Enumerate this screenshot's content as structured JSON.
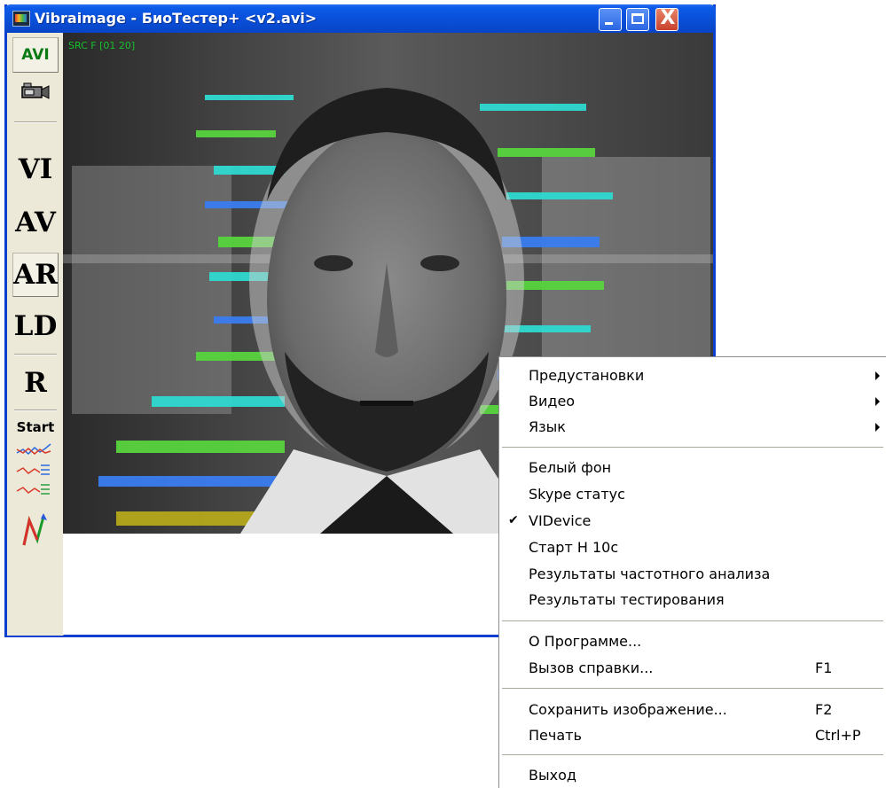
{
  "window": {
    "title": "Vibraimage - БиоТестер+ <v2.avi>",
    "close_glyph": "X"
  },
  "toolbar": {
    "avi": "AVI",
    "vi": "VI",
    "av": "AV",
    "ar": "AR",
    "ld": "LD",
    "r": "R",
    "start": "Start"
  },
  "video": {
    "overlay_label": "SRC F [01 20]"
  },
  "context_menu": {
    "items": [
      {
        "label": "Предустановки",
        "submenu": true
      },
      {
        "label": "Видео",
        "submenu": true
      },
      {
        "label": "Язык",
        "submenu": true
      },
      {
        "label": "Белый фон"
      },
      {
        "label": "Skype статус"
      },
      {
        "label": "VIDevice",
        "checked": true,
        "check_glyph": "✔"
      },
      {
        "label": "Старт Н 10с"
      },
      {
        "label": "Результаты частотного анализа"
      },
      {
        "label": "Результаты тестирования"
      },
      {
        "label": "О Программе..."
      },
      {
        "label": "Вызов справки...",
        "shortcut": "F1"
      },
      {
        "label": "Сохранить изображение...",
        "shortcut": "F2"
      },
      {
        "label": "Печать",
        "shortcut": "Ctrl+P"
      },
      {
        "label": "Выход"
      }
    ]
  },
  "colors": {
    "titlebar": "#0a4fd8",
    "window_face": "#ece9d8",
    "overlay_green": "#17c02a",
    "aura_cyan": "#2fd9d0",
    "aura_green": "#57d43e",
    "aura_blue": "#3a7df0",
    "aura_olive": "#b5a81c"
  }
}
